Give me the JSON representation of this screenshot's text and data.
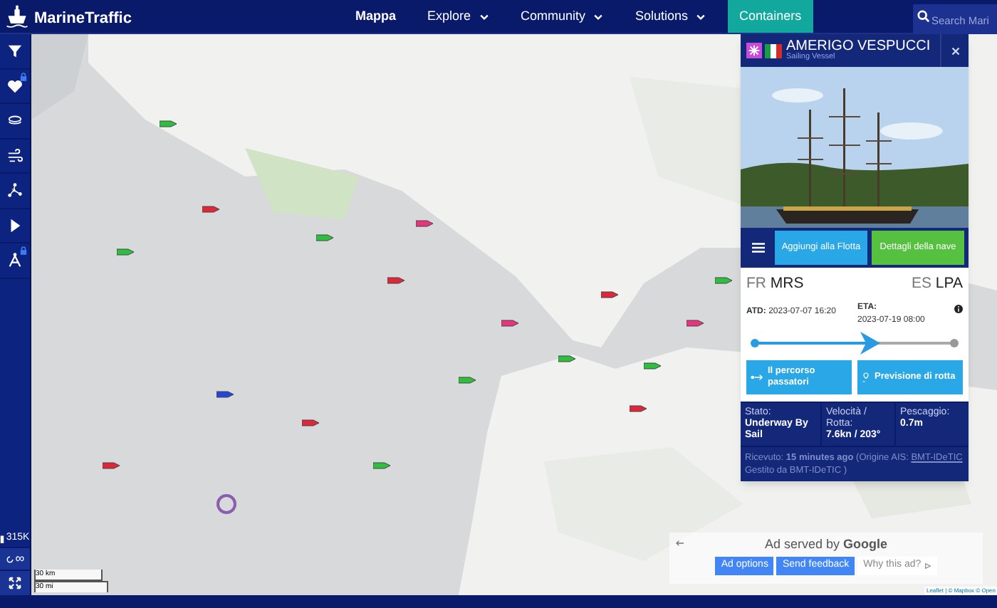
{
  "top_bar": {
    "logo": "MarineTraffic",
    "nav": [
      {
        "label": "Mappa",
        "selected": true,
        "kind": "link",
        "dropdown": false
      },
      {
        "label": "Explore",
        "selected": false,
        "kind": "link",
        "dropdown": true
      },
      {
        "label": "Community",
        "selected": false,
        "kind": "link",
        "dropdown": true
      },
      {
        "label": "Solutions",
        "selected": false,
        "kind": "link",
        "dropdown": true
      },
      {
        "label": "Containers",
        "selected": false,
        "kind": "highlight",
        "dropdown": false
      }
    ],
    "search": {
      "placeholder": "Search Mari"
    }
  },
  "sidebar": {
    "tools": [
      {
        "kind": "filter",
        "locked": false
      },
      {
        "kind": "heart",
        "locked": true
      },
      {
        "kind": "layers",
        "locked": false
      },
      {
        "kind": "wind",
        "locked": false
      },
      {
        "kind": "network",
        "locked": false
      },
      {
        "kind": "play",
        "locked": false
      },
      {
        "kind": "compass",
        "locked": true
      }
    ],
    "vessel_count": "315K",
    "loop_label": "∞"
  },
  "map": {
    "kind": "picture",
    "scale": [
      "30 km",
      "30 mi"
    ],
    "attribution": "Leaflet | © Mapbox © Open"
  },
  "vessel_panel": {
    "name": "AMERIGO VESPUCCI",
    "type": "Sailing Vessel",
    "actions": [
      "Aggiungi alla Flotta",
      "Dettagli della nave"
    ],
    "departure": {
      "country": "FR",
      "port": "MRS"
    },
    "arrival": {
      "country": "ES",
      "port": "LPA"
    },
    "atd": {
      "label": "ATD:",
      "value": "2023-07-07 16:20"
    },
    "eta": {
      "label": "ETA:",
      "value": "2023-07-19 08:00"
    },
    "progress": {
      "level": 0.6
    },
    "route_buttons": [
      {
        "kind": "track",
        "label": "Il percorso passatori"
      },
      {
        "kind": "forecast",
        "label": "Previsione di rotta"
      }
    ],
    "stats": [
      {
        "label": "Stato:",
        "value": "Underway By Sail"
      },
      {
        "label": "Velocità / Rotta:",
        "value": "7.6kn / 203°"
      },
      {
        "label": "Pescaggio:",
        "value": "0.7m"
      }
    ],
    "received": {
      "text": "Ricevuto: **15 minutes ago** (Origine AIS:",
      "link": "BMT-IDeTIC",
      "rest": "Gestito da BMT-IDeTIC )"
    }
  },
  "ad": {
    "text": "Ad served by **Google**",
    "buttons": [
      "Ad options",
      "Send feedback"
    ],
    "why": "Why this ad?"
  }
}
